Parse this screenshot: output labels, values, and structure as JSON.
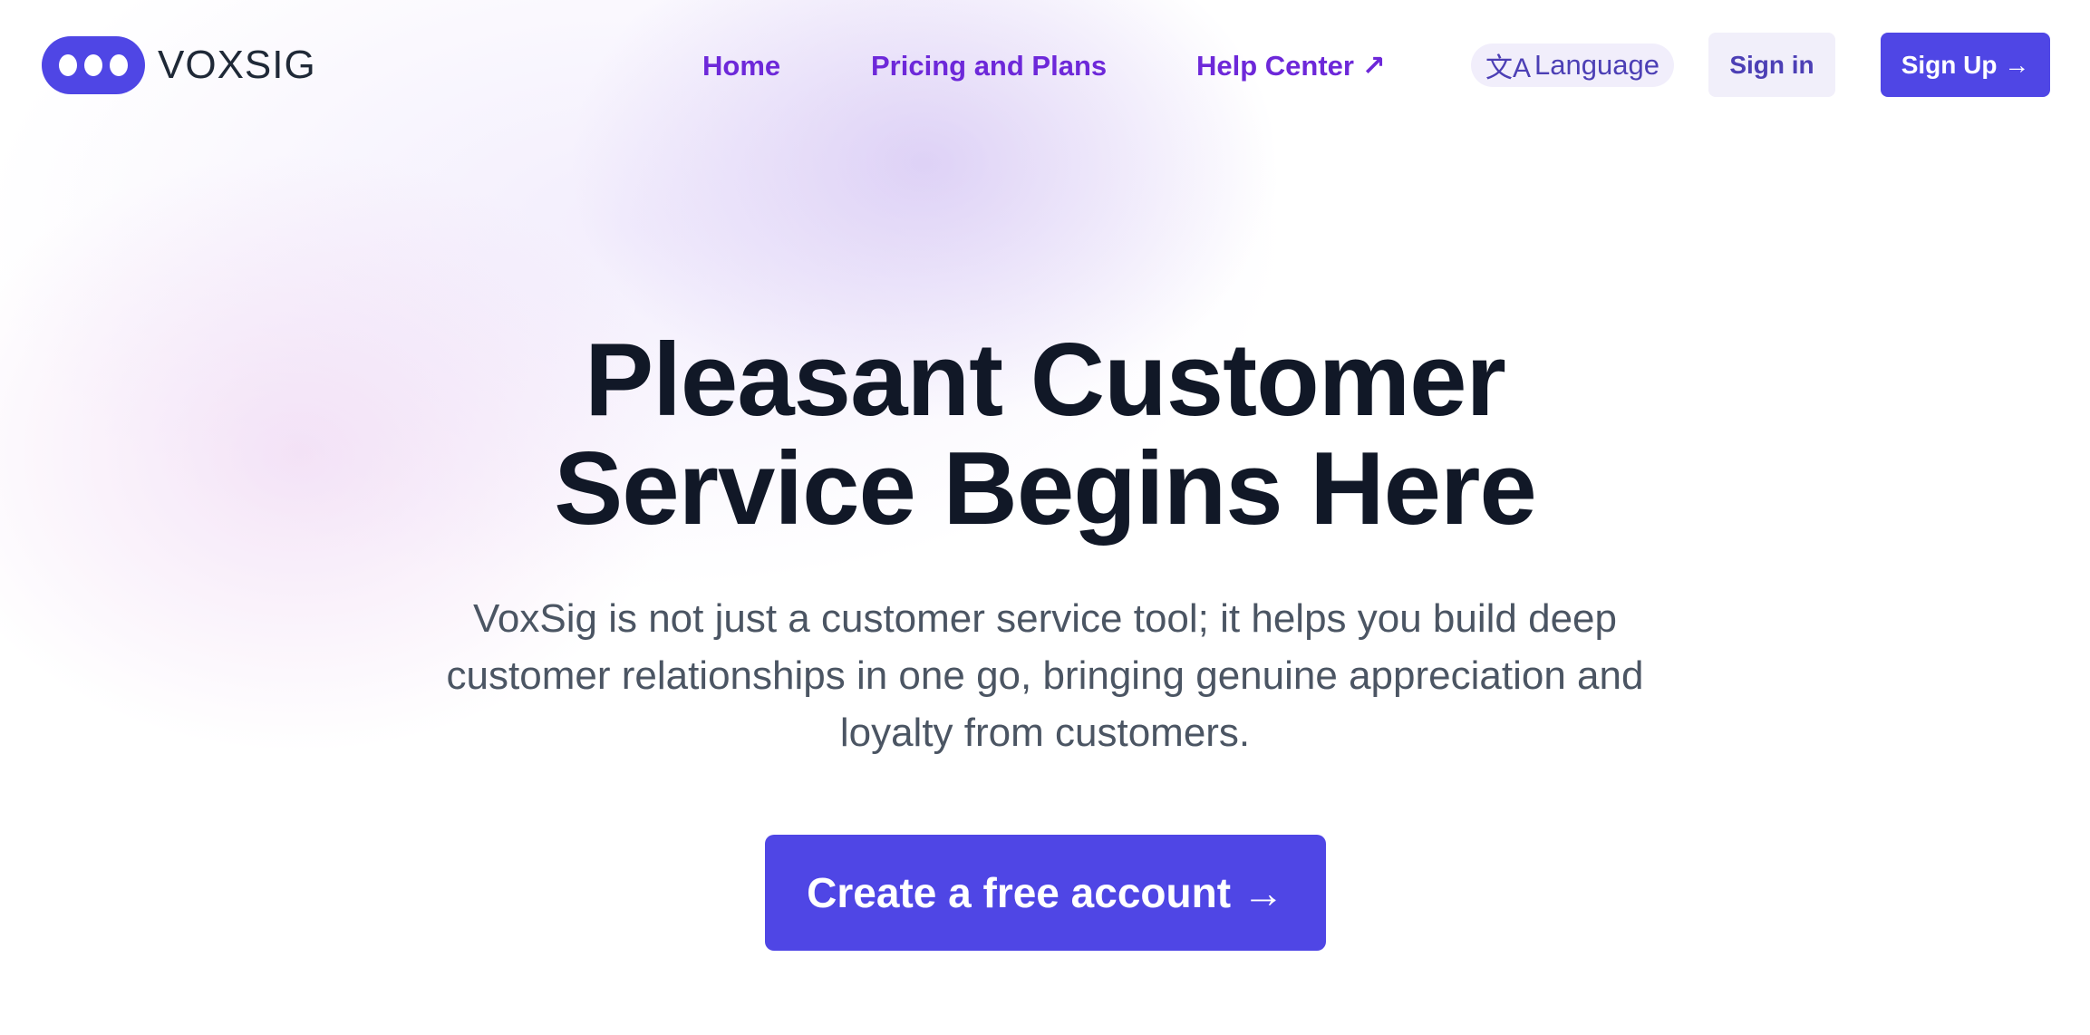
{
  "header": {
    "logo_text": "VOXSIG",
    "nav": [
      {
        "label": "Home"
      },
      {
        "label": "Pricing and Plans"
      },
      {
        "label": "Help Center ↗"
      }
    ],
    "language_label": "Language",
    "language_icon": "translate-icon",
    "signin_label": "Sign in",
    "signup_label": "Sign Up →"
  },
  "hero": {
    "title_line1": "Pleasant Customer",
    "title_line2": "Service Begins Here",
    "subtitle": "VoxSig is not just a customer service tool; it helps you build deep customer relationships in one go, bringing genuine appreciation and loyalty from customers.",
    "cta_label": "Create a free account →"
  },
  "colors": {
    "primary": "#4f46e5",
    "nav_text": "#6d28d9",
    "heading": "#111827"
  }
}
